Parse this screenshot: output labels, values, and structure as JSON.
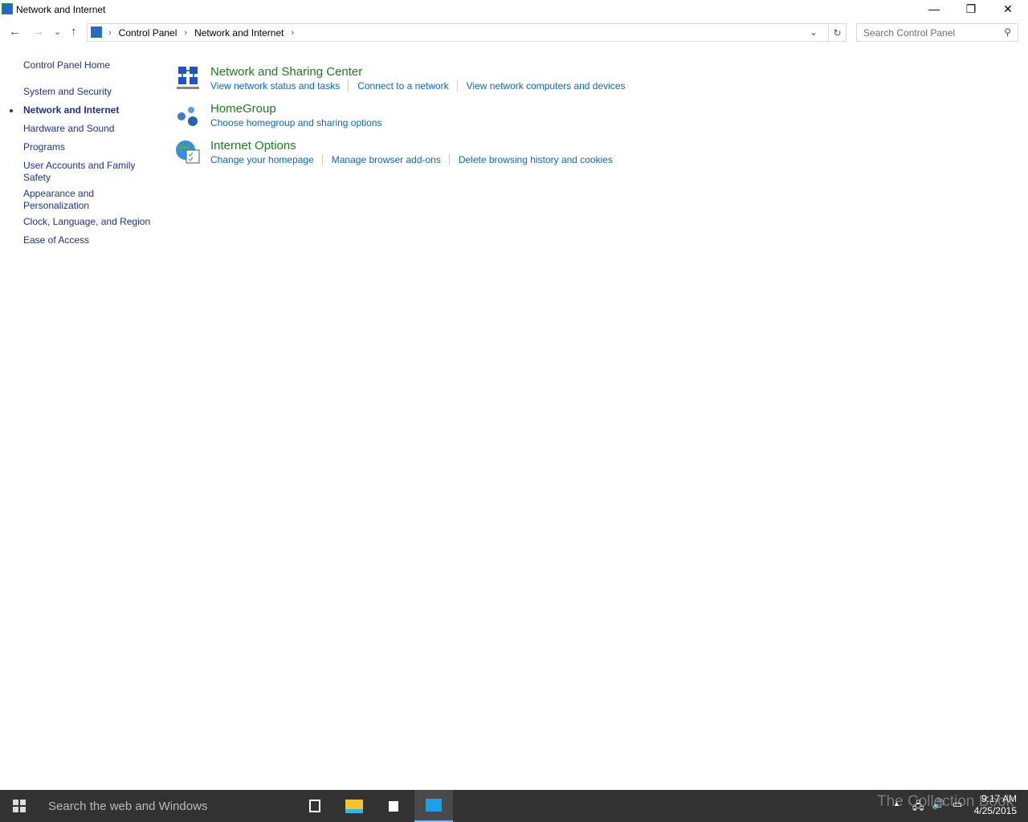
{
  "window": {
    "title": "Network and Internet",
    "min": "—",
    "restore": "❐",
    "close": "✕"
  },
  "nav": {
    "back": "←",
    "forward": "→",
    "recent": "⌄",
    "up": "↑",
    "breadcrumb": [
      "Control Panel",
      "Network and Internet"
    ],
    "sep": "›",
    "dropdown": "⌄",
    "refresh": "↻",
    "search_placeholder": "Search Control Panel",
    "search_icon": "⚲"
  },
  "sidebar": {
    "home": "Control Panel Home",
    "items": [
      "System and Security",
      "Network and Internet",
      "Hardware and Sound",
      "Programs",
      "User Accounts and Family Safety",
      "Appearance and Personalization",
      "Clock, Language, and Region",
      "Ease of Access"
    ]
  },
  "categories": [
    {
      "title": "Network and Sharing Center",
      "links": [
        "View network status and tasks",
        "Connect to a network",
        "View network computers and devices"
      ]
    },
    {
      "title": "HomeGroup",
      "links": [
        "Choose homegroup and sharing options"
      ]
    },
    {
      "title": "Internet Options",
      "links": [
        "Change your homepage",
        "Manage browser add-ons",
        "Delete browsing history and cookies"
      ]
    }
  ],
  "taskbar": {
    "search": "Search the web and Windows",
    "time": "9:17 AM",
    "date": "4/25/2015",
    "watermark": "The Collection Book"
  }
}
